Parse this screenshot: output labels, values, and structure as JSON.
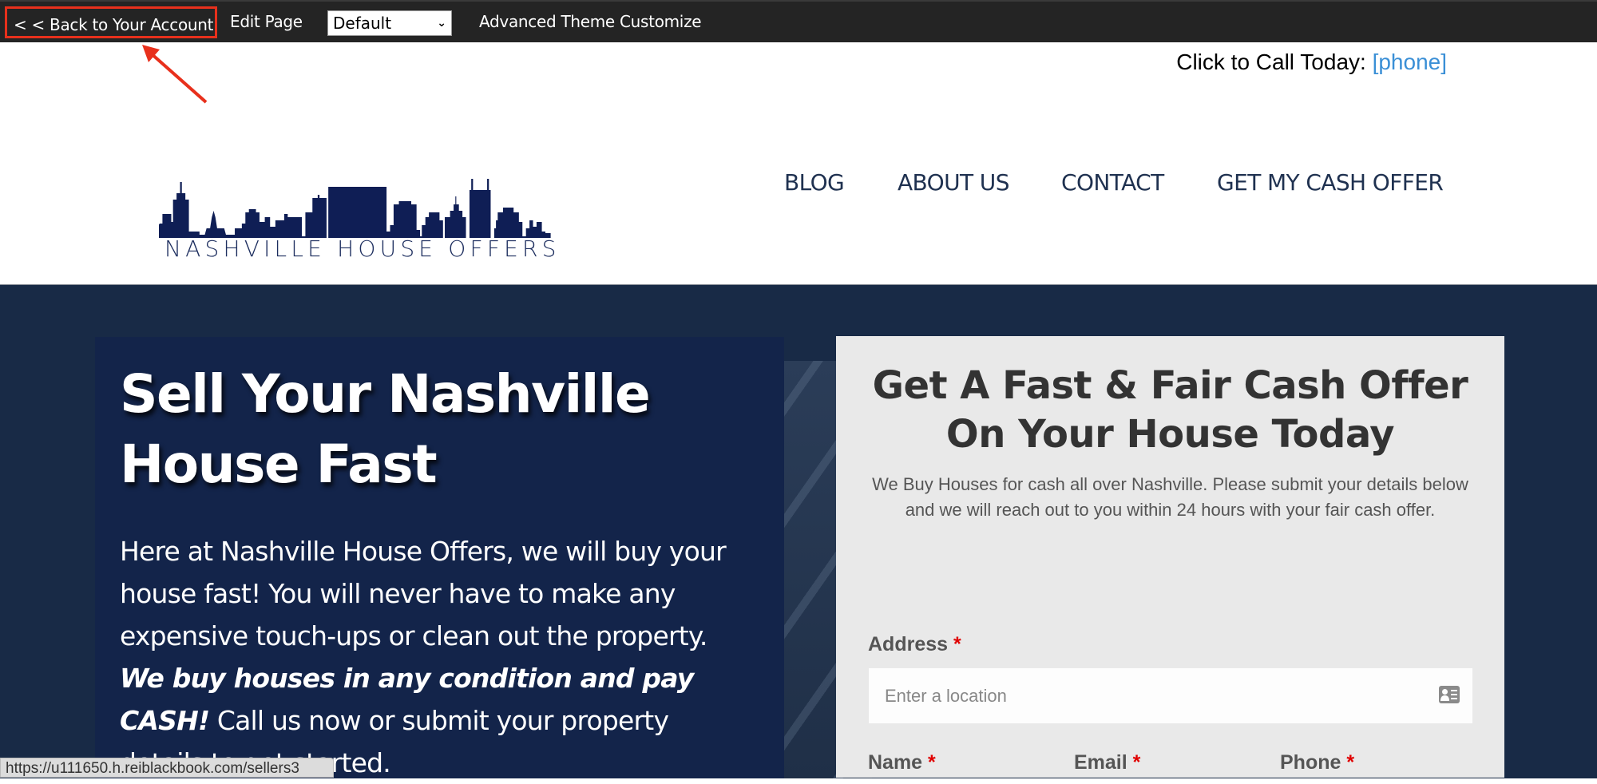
{
  "admin_bar": {
    "back_label": "< < Back to Your Account",
    "edit_label": "Edit Page",
    "theme_select_value": "Default",
    "advanced_label": "Advanced Theme Customize"
  },
  "header": {
    "call_label": "Click to Call Today:",
    "phone_link": "[phone]",
    "logo_text": "NASHVILLE HOUSE OFFERS",
    "nav": [
      "BLOG",
      "ABOUT US",
      "CONTACT",
      "GET MY CASH OFFER"
    ]
  },
  "hero": {
    "title_line1": "Sell Your Nashville",
    "title_line2": "House Fast",
    "para_part1": "Here at Nashville House Offers, we will buy your house fast! You will never have to make any expensive touch-ups or clean out the property. ",
    "para_emphasis": "We buy houses in any condition and pay CASH!",
    "para_part2": " Call us now or submit your property details to get started."
  },
  "form": {
    "title_line1": "Get A Fast & Fair Cash Offer",
    "title_line2": "On Your House Today",
    "subtitle": "We Buy Houses for cash all over Nashville. Please submit your details below and we will reach out to you within 24 hours with your fair cash offer.",
    "address_label": "Address",
    "address_placeholder": "Enter a location",
    "name_label": "Name",
    "email_label": "Email",
    "phone_label": "Phone",
    "required_marker": "*"
  },
  "status_bar": {
    "url": "https://u111650.h.reiblackbook.com/sellers3"
  },
  "colors": {
    "admin_bg": "#242424",
    "highlight_red": "#e8301c",
    "link_blue": "#3a8fd6",
    "brand_navy": "#13244a",
    "hero_bg": "#182a46",
    "card_bg": "#e9e9e9",
    "required_red": "#e00000"
  }
}
